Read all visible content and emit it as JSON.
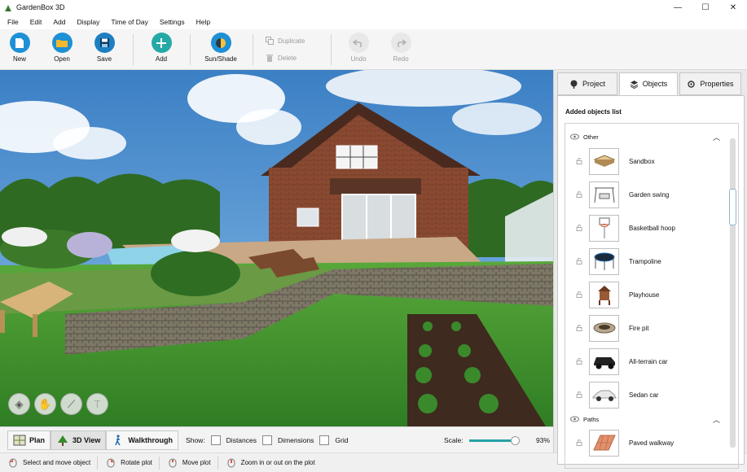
{
  "window": {
    "title": "GardenBox 3D",
    "controls": [
      "—",
      "☐",
      "✕"
    ]
  },
  "menu": [
    "File",
    "Edit",
    "Add",
    "Display",
    "Time of Day",
    "Settings",
    "Help"
  ],
  "toolbar": {
    "new_label": "New",
    "open_label": "Open",
    "save_label": "Save",
    "add_label": "Add",
    "sunshade_label": "Sun/Shade",
    "duplicate_label": "Duplicate",
    "delete_label": "Delete",
    "undo_label": "Undo",
    "redo_label": "Redo"
  },
  "view_bar": {
    "plan_label": "Plan",
    "view3d_label": "3D View",
    "walkthrough_label": "Walkthrough",
    "show_label": "Show:",
    "options": [
      "Distances",
      "Dimensions",
      "Grid"
    ],
    "scale_label": "Scale:",
    "scale_value": "93%",
    "scale_fraction": 0.93
  },
  "status_bar": {
    "hints": [
      "Select and move object",
      "Rotate plot",
      "Move plot",
      "Zoom in or out on the plot"
    ]
  },
  "panel": {
    "tabs": [
      "Project",
      "Objects",
      "Properties"
    ],
    "active_tab": "Objects",
    "list_title": "Added objects list",
    "groups": [
      {
        "name": "Other",
        "items": [
          "Sandbox",
          "Garden swing",
          "Basketball hoop",
          "Trampoline",
          "Playhouse",
          "Fire pit",
          "All-terrain car",
          "Sedan car"
        ]
      },
      {
        "name": "Paths",
        "items": [
          "Paved walkway"
        ]
      }
    ]
  },
  "colors": {
    "accent_blue": "#1e90d6",
    "accent_teal": "#26a9a6",
    "save_blue": "#1c7fc1",
    "open_yellow": "#f5b82e",
    "grass_green": "#3f8f2e"
  }
}
